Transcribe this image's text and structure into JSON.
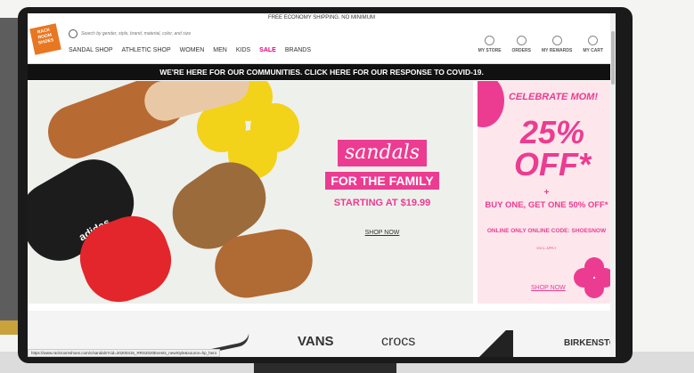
{
  "top_bar": {
    "text": "FREE ECONOMY SHIPPING. NO MINIMUM"
  },
  "logo": {
    "text": "RACK ROOM SHOES"
  },
  "search": {
    "placeholder": "Search by gender, style, brand, material, color, and size"
  },
  "nav": {
    "items": [
      "SANDAL SHOP",
      "ATHLETIC SHOP",
      "WOMEN",
      "MEN",
      "KIDS",
      "SALE",
      "BRANDS"
    ]
  },
  "utility": {
    "store": "MY STORE",
    "orders": "ORDERS",
    "rewards": "MY REWARDS",
    "cart": "MY CART"
  },
  "covid_banner": "WE'RE HERE FOR OUR COMMUNITIES. CLICK HERE FOR OUR RESPONSE TO COVID-19.",
  "hero": {
    "headline": "sandals",
    "subhead": "FOR THE FAMILY",
    "price": "STARTING AT $19.99",
    "cta": "SHOP NOW",
    "shoe_brand": "adidas"
  },
  "promo": {
    "celebrate": "CELEBRATE MOM!",
    "discount": "25% OFF*",
    "plus": "+",
    "bogo": "BUY ONE, GET ONE 50% OFF*",
    "online": "ONLINE ONLY ONLINE CODE: SHOESNOW",
    "fine_print": "EXCL. APPLY",
    "cta": "SHOP NOW"
  },
  "brands": [
    "VANS",
    "crocs",
    "BIRKENSTOCK"
  ],
  "status_url": "https://www.rackroomshoes.com/c/sandals?cid=20200415_RRS2020Events_newStyle&source=hp_hero",
  "colors": {
    "accent_pink": "#ec3c91",
    "sale": "#e6007e",
    "logo_orange": "#e87722",
    "banner_black": "#111111"
  }
}
